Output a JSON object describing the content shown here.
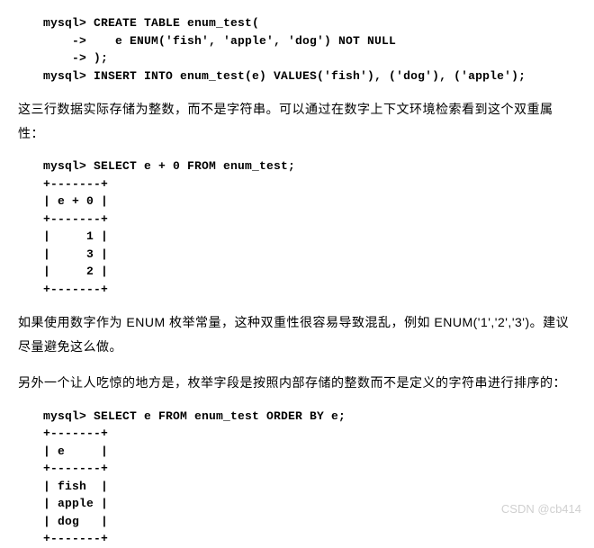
{
  "code_block_1": "mysql> CREATE TABLE enum_test(\n    ->    e ENUM('fish', 'apple', 'dog') NOT NULL\n    -> );\nmysql> INSERT INTO enum_test(e) VALUES('fish'), ('dog'), ('apple');",
  "paragraph_1": "这三行数据实际存储为整数，而不是字符串。可以通过在数字上下文环境检索看到这个双重属性：",
  "code_block_2": "mysql> SELECT e + 0 FROM enum_test;\n+-------+\n| e + 0 |\n+-------+\n|     1 |\n|     3 |\n|     2 |\n+-------+",
  "paragraph_2": "如果使用数字作为 ENUM 枚举常量，这种双重性很容易导致混乱，例如 ENUM('1','2','3')。建议尽量避免这么做。",
  "paragraph_3": "另外一个让人吃惊的地方是，枚举字段是按照内部存储的整数而不是定义的字符串进行排序的：",
  "code_block_3": "mysql> SELECT e FROM enum_test ORDER BY e;\n+-------+\n| e     |\n+-------+\n| fish  |\n| apple |\n| dog   |\n+-------+",
  "watermark": "CSDN @cb414",
  "chart_data": {
    "type": "table",
    "tables": [
      {
        "title": "SELECT e + 0 FROM enum_test",
        "columns": [
          "e + 0"
        ],
        "rows": [
          [
            1
          ],
          [
            3
          ],
          [
            2
          ]
        ]
      },
      {
        "title": "SELECT e FROM enum_test ORDER BY e",
        "columns": [
          "e"
        ],
        "rows": [
          [
            "fish"
          ],
          [
            "apple"
          ],
          [
            "dog"
          ]
        ]
      }
    ]
  }
}
